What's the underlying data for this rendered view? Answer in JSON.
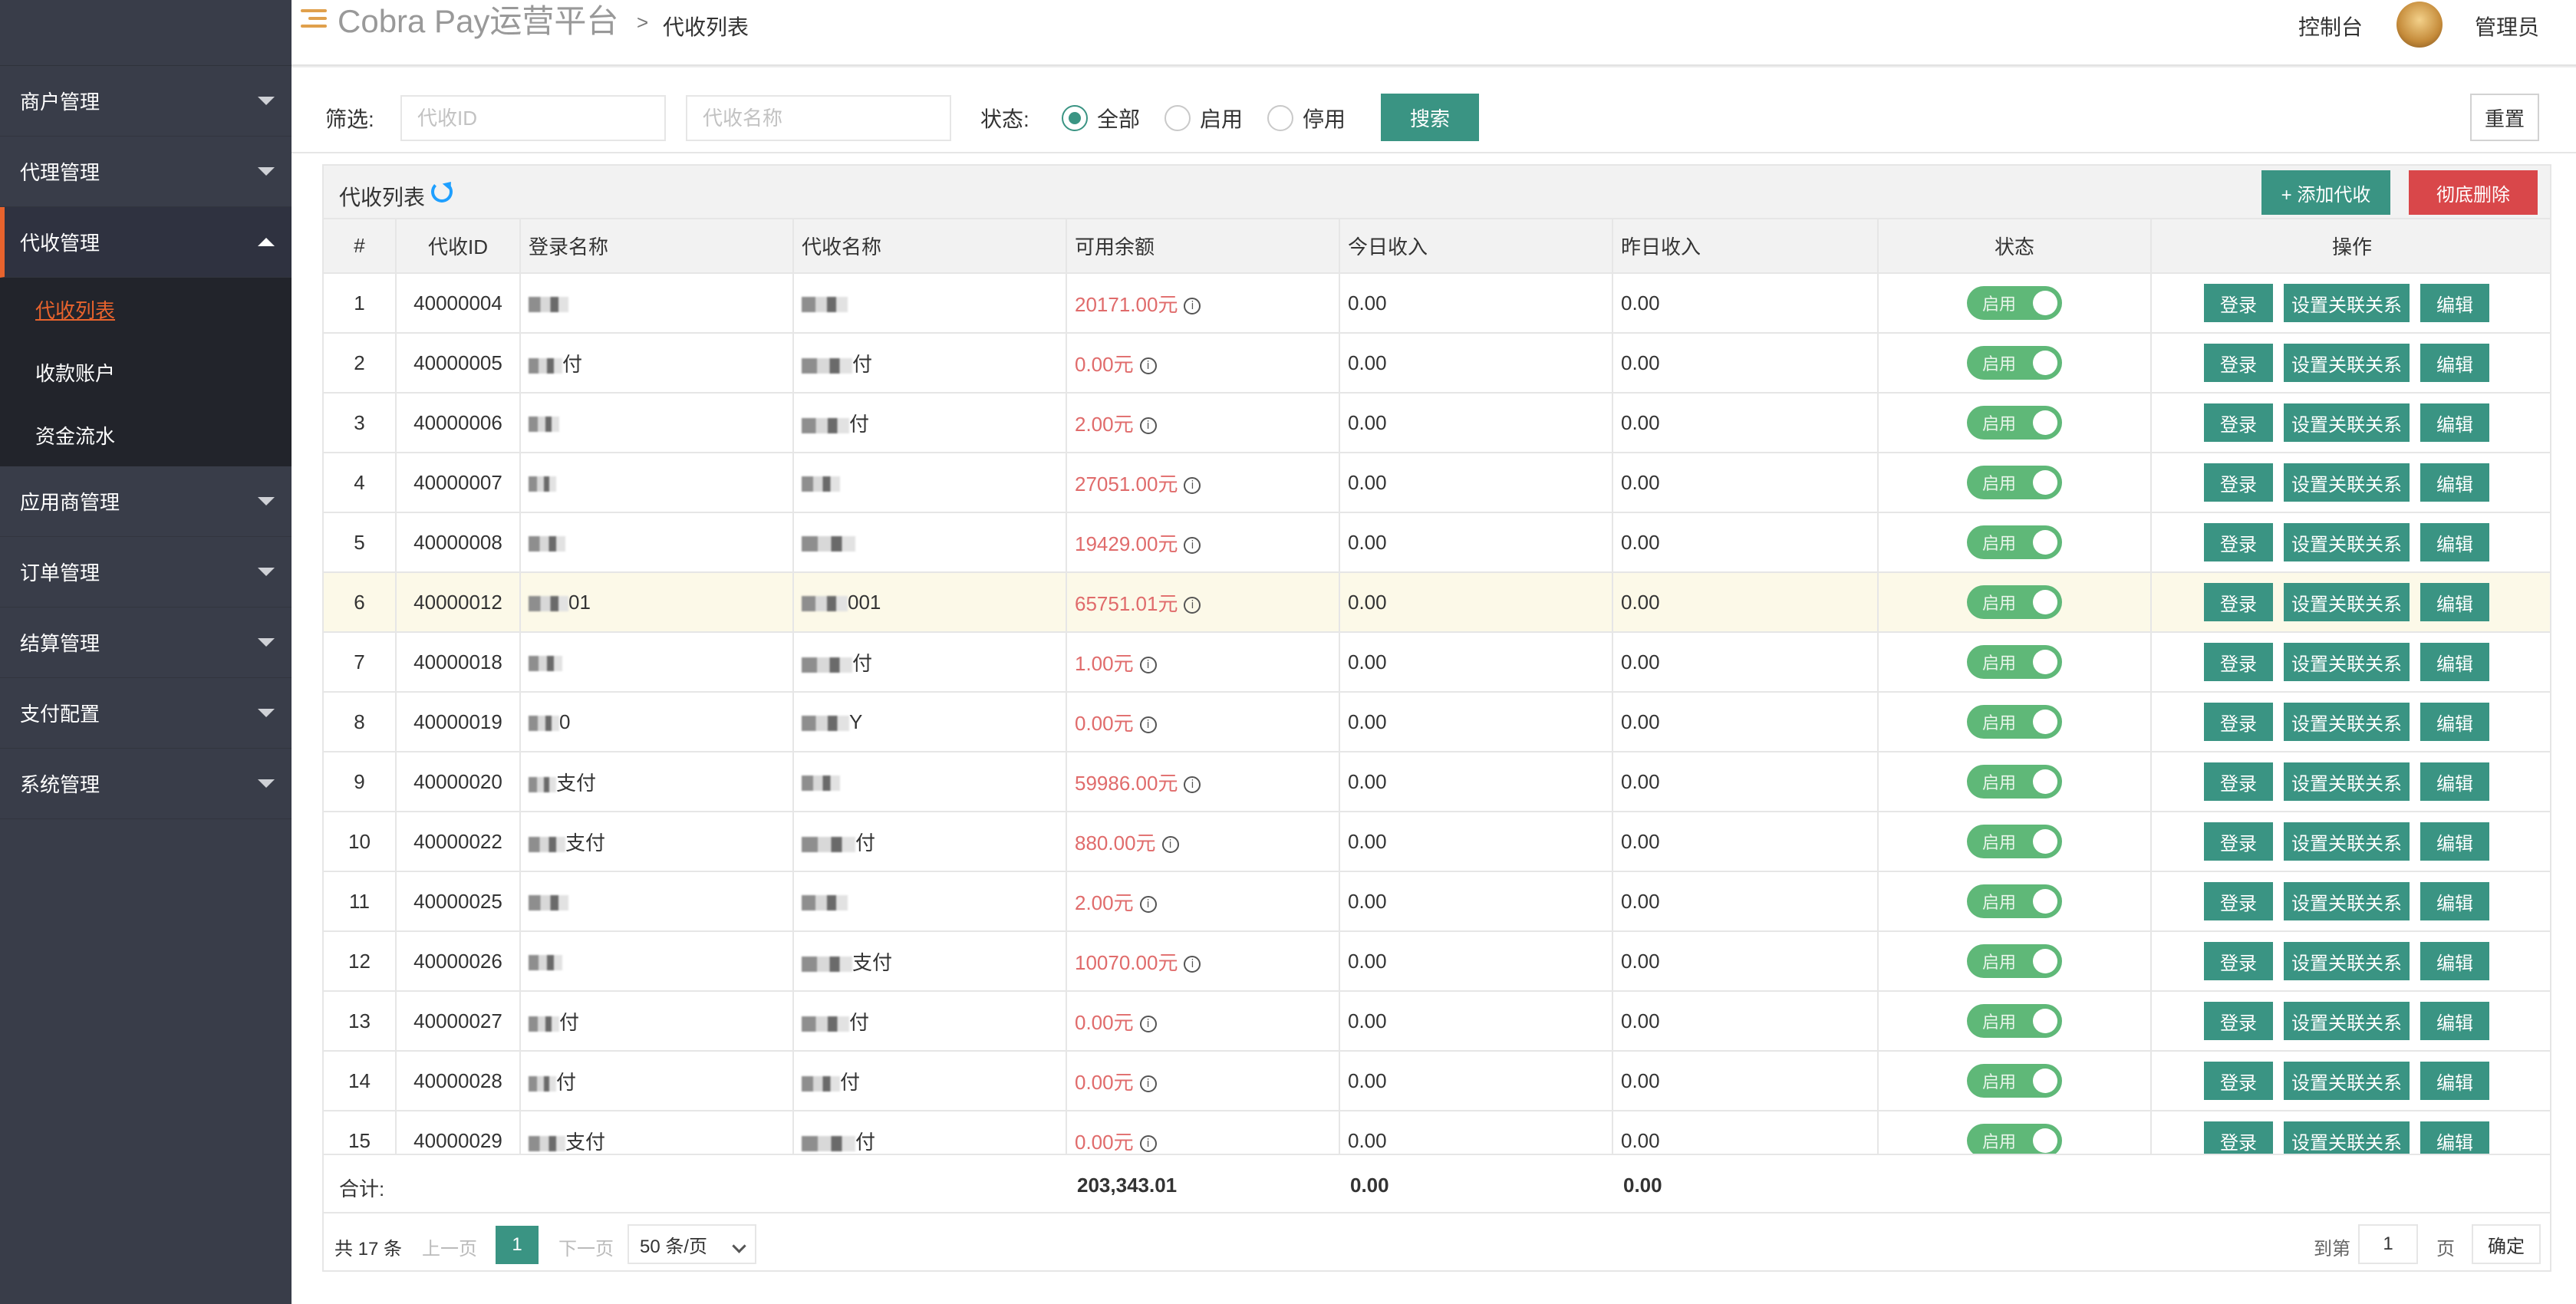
{
  "header": {
    "title": "Cobra Pay运营平台",
    "breadcrumb_sep": ">",
    "breadcrumb": "代收列表",
    "console": "控制台",
    "user": "管理员"
  },
  "sidebar": {
    "items": [
      {
        "label": "商户管理"
      },
      {
        "label": "代理管理"
      },
      {
        "label": "代收管理"
      },
      {
        "label": "应用商管理"
      },
      {
        "label": "订单管理"
      },
      {
        "label": "结算管理"
      },
      {
        "label": "支付配置"
      },
      {
        "label": "系统管理"
      }
    ],
    "sub_items": [
      {
        "label": "代收列表"
      },
      {
        "label": "收款账户"
      },
      {
        "label": "资金流水"
      }
    ]
  },
  "filter": {
    "label": "筛选:",
    "id_placeholder": "代收ID",
    "name_placeholder": "代收名称",
    "status_label": "状态:",
    "radio_all": "全部",
    "radio_enabled": "启用",
    "radio_disabled": "停用",
    "search": "搜索",
    "reset": "重置"
  },
  "panel": {
    "title": "代收列表",
    "add": "+ 添加代收",
    "delete": "彻底删除"
  },
  "table": {
    "headers": [
      "#",
      "代收ID",
      "登录名称",
      "代收名称",
      "可用余额",
      "今日收入",
      "昨日收入",
      "状态",
      "操作"
    ],
    "rows": [
      {
        "no": "1",
        "id": "40000004",
        "login": "",
        "name": "",
        "balance": "20171.00元",
        "today": "0.00",
        "yesterday": "0.00"
      },
      {
        "no": "2",
        "id": "40000005",
        "login": "付",
        "name": "付",
        "balance": "0.00元",
        "today": "0.00",
        "yesterday": "0.00"
      },
      {
        "no": "3",
        "id": "40000006",
        "login": "",
        "name": "付",
        "balance": "2.00元",
        "today": "0.00",
        "yesterday": "0.00"
      },
      {
        "no": "4",
        "id": "40000007",
        "login": "",
        "name": "",
        "balance": "27051.00元",
        "today": "0.00",
        "yesterday": "0.00"
      },
      {
        "no": "5",
        "id": "40000008",
        "login": "",
        "name": "",
        "balance": "19429.00元",
        "today": "0.00",
        "yesterday": "0.00"
      },
      {
        "no": "6",
        "id": "40000012",
        "login": "01",
        "name": "001",
        "balance": "65751.01元",
        "today": "0.00",
        "yesterday": "0.00"
      },
      {
        "no": "7",
        "id": "40000018",
        "login": "",
        "name": "付",
        "balance": "1.00元",
        "today": "0.00",
        "yesterday": "0.00"
      },
      {
        "no": "8",
        "id": "40000019",
        "login": "0",
        "name": "Y",
        "balance": "0.00元",
        "today": "0.00",
        "yesterday": "0.00"
      },
      {
        "no": "9",
        "id": "40000020",
        "login": "支付",
        "name": "",
        "balance": "59986.00元",
        "today": "0.00",
        "yesterday": "0.00"
      },
      {
        "no": "10",
        "id": "40000022",
        "login": "支付",
        "name": "付",
        "balance": "880.00元",
        "today": "0.00",
        "yesterday": "0.00"
      },
      {
        "no": "11",
        "id": "40000025",
        "login": "",
        "name": "",
        "balance": "2.00元",
        "today": "0.00",
        "yesterday": "0.00"
      },
      {
        "no": "12",
        "id": "40000026",
        "login": "",
        "name": "支付",
        "balance": "10070.00元",
        "today": "0.00",
        "yesterday": "0.00"
      },
      {
        "no": "13",
        "id": "40000027",
        "login": "付",
        "name": "付",
        "balance": "0.00元",
        "today": "0.00",
        "yesterday": "0.00"
      },
      {
        "no": "14",
        "id": "40000028",
        "login": "付",
        "name": "付",
        "balance": "0.00元",
        "today": "0.00",
        "yesterday": "0.00"
      },
      {
        "no": "15",
        "id": "40000029",
        "login": "支付",
        "name": "付",
        "balance": "0.00元",
        "today": "0.00",
        "yesterday": "0.00"
      }
    ],
    "status_label": "启用",
    "op_login": "登录",
    "op_relation": "设置关联关系",
    "op_edit": "编辑"
  },
  "total": {
    "label": "合计:",
    "balance": "203,343.01",
    "today": "0.00",
    "yesterday": "0.00"
  },
  "pager": {
    "count": "共 17 条",
    "prev": "上一页",
    "page": "1",
    "next": "下一页",
    "size": "50 条/页",
    "goto": "到第",
    "goto_value": "1",
    "page_unit": "页",
    "confirm": "确定"
  },
  "colors": {
    "accent": "#3a9483",
    "danger": "#d9474a",
    "sidebar": "#393d49",
    "active_nav": "#e8632d",
    "balance": "#e06b6b",
    "toggle": "#5fb878"
  }
}
